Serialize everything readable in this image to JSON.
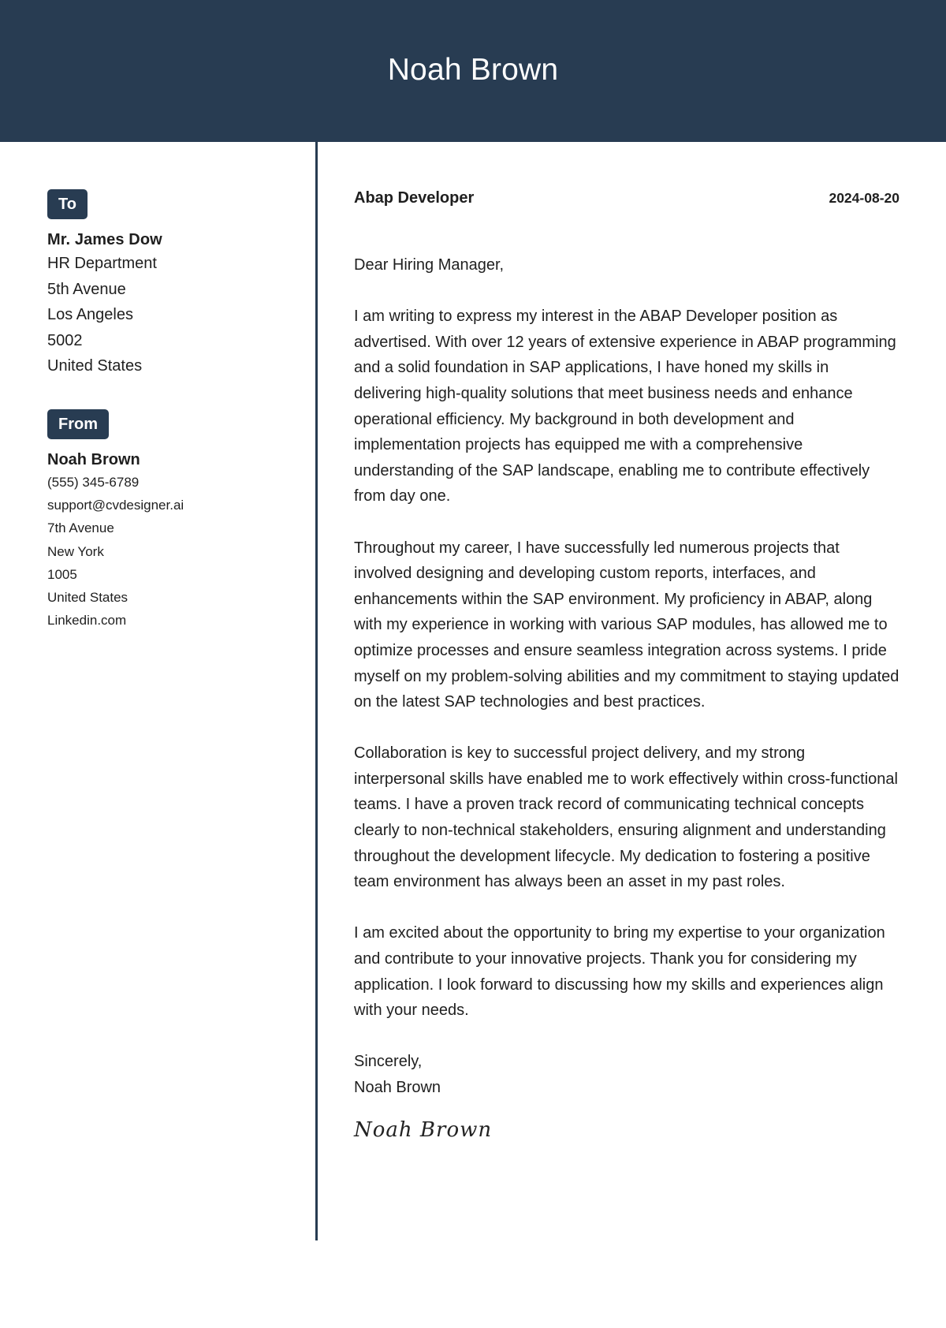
{
  "header": {
    "name": "Noah Brown"
  },
  "recipient": {
    "badge": "To",
    "name": "Mr. James Dow",
    "lines": [
      "HR Department",
      "5th Avenue",
      "Los Angeles",
      "5002",
      "United States"
    ]
  },
  "sender": {
    "badge": "From",
    "name": "Noah Brown",
    "lines": [
      "(555) 345-6789",
      "support@cvdesigner.ai",
      "7th Avenue",
      "New York",
      "1005",
      "United States",
      "Linkedin.com"
    ]
  },
  "letter": {
    "job_title": "Abap Developer",
    "date": "2024-08-20",
    "salutation": "Dear Hiring Manager,",
    "paragraphs": [
      "I am writing to express my interest in the ABAP Developer position as advertised. With over 12 years of extensive experience in ABAP programming and a solid foundation in SAP applications, I have honed my skills in delivering high-quality solutions that meet business needs and enhance operational efficiency. My background in both development and implementation projects has equipped me with a comprehensive understanding of the SAP landscape, enabling me to contribute effectively from day one.",
      "Throughout my career, I have successfully led numerous projects that involved designing and developing custom reports, interfaces, and enhancements within the SAP environment. My proficiency in ABAP, along with my experience in working with various SAP modules, has allowed me to optimize processes and ensure seamless integration across systems. I pride myself on my problem-solving abilities and my commitment to staying updated on the latest SAP technologies and best practices.",
      "Collaboration is key to successful project delivery, and my strong interpersonal skills have enabled me to work effectively within cross-functional teams. I have a proven track record of communicating technical concepts clearly to non-technical stakeholders, ensuring alignment and understanding throughout the development lifecycle. My dedication to fostering a positive team environment has always been an asset in my past roles.",
      "I am excited about the opportunity to bring my expertise to your organization and contribute to your innovative projects. Thank you for considering my application. I look forward to discussing how my skills and experiences align with your needs."
    ],
    "closing": "Sincerely,",
    "closing_name": "Noah Brown",
    "signature": "Noah Brown"
  },
  "colors": {
    "accent": "#283c52",
    "text": "#1f1f1f",
    "background": "#ffffff"
  }
}
